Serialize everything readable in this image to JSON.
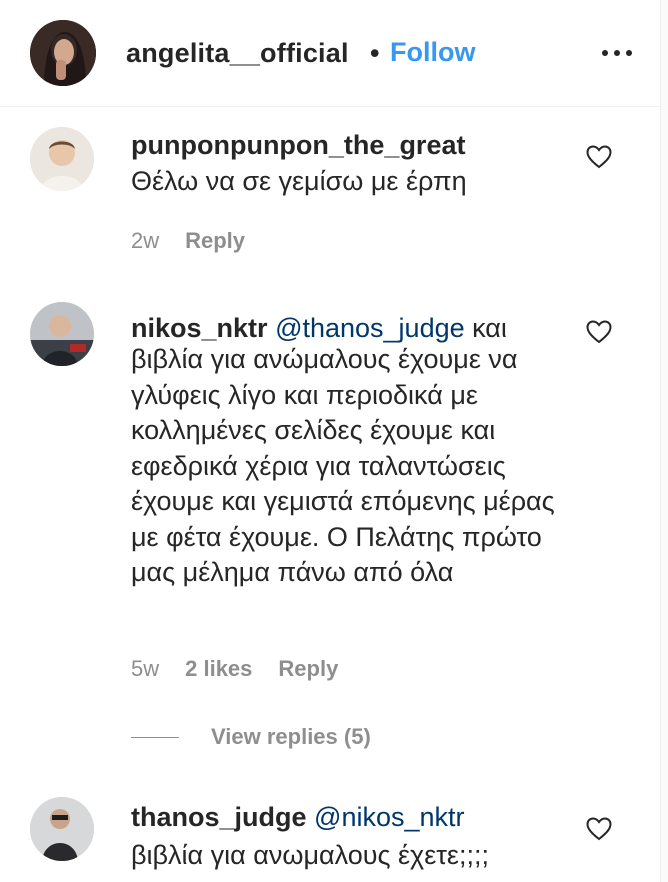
{
  "post_header": {
    "username": "angelita__official",
    "separator": "•",
    "follow_label": "Follow"
  },
  "comments": [
    {
      "username": "punponpunpon_the_great",
      "mention": "",
      "text": "Θέλω να σε γεμίσω με έρπη",
      "time": "2w",
      "likes": "",
      "reply_label": "Reply"
    },
    {
      "username": "nikos_nktr",
      "mention": "@thanos_judge",
      "first_line_tail": "και",
      "text": "βιβλία για ανώμαλους έχουμε να γλύφεις λίγο και περιοδικά με κολλημένες σελίδες έχουμε και εφεδρικά χέρια για ταλαντώσεις έχουμε και γεμιστά επόμενης μέρας με φέτα έχουμε. Ο Πελάτης πρώτο μας μέλημα πάνω από όλα",
      "time": "5w",
      "likes": "2 likes",
      "reply_label": "Reply",
      "view_replies": "View replies (5)"
    },
    {
      "username": "thanos_judge",
      "mention": "@nikos_nktr",
      "text": "βιβλία για ανωμαλους έχετε;;;;",
      "time": "",
      "likes": "",
      "reply_label": ""
    }
  ],
  "icons": {
    "more": "more-options-icon",
    "like": "heart-outline-icon"
  },
  "colors": {
    "link_blue": "#3897f0",
    "mention_blue": "#00376b",
    "text": "#262626",
    "muted": "#8e8e8e"
  }
}
